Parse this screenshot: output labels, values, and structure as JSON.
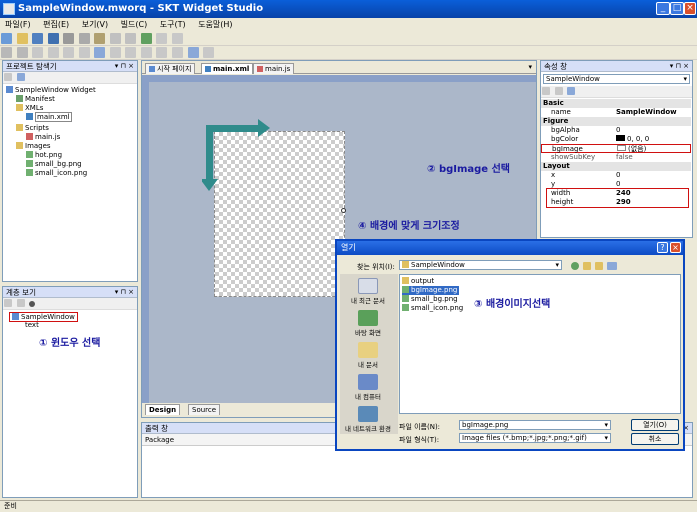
{
  "window": {
    "title": "SampleWindow.mworq - SKT Widget Studio"
  },
  "menu": [
    "파일(F)",
    "편집(E)",
    "보기(V)",
    "빌드(C)",
    "도구(T)",
    "도움말(H)"
  ],
  "project_explorer": {
    "title": "프로젝트 탐색기",
    "items": [
      "SampleWindow Widget",
      "Manifest",
      "XMLs",
      "main.xml",
      "Scripts",
      "main.js",
      "Images",
      "hot.png",
      "small_bg.png",
      "small_icon.png"
    ]
  },
  "layer_view": {
    "title": "계층 보기",
    "items": [
      "SampleWindow",
      "text"
    ]
  },
  "tabs": [
    "시작 페이지",
    "main.xml",
    "main.js"
  ],
  "bottom_tabs": {
    "design": "Design",
    "source": "Source"
  },
  "output": {
    "title": "출력 창",
    "package_label": "Package"
  },
  "properties": {
    "title": "속성 창",
    "object": "SampleWindow",
    "categories": {
      "basic": "Basic",
      "figure": "Figure",
      "layout": "Layout"
    },
    "rows": {
      "name": {
        "k": "name",
        "v": "SampleWindow"
      },
      "bgAlpha": {
        "k": "bgAlpha",
        "v": "0"
      },
      "bgColor": {
        "k": "bgColor",
        "v": "0, 0, 0"
      },
      "bgImage": {
        "k": "bgImage",
        "v": "(없음)"
      },
      "showSubKey": {
        "k": "showSubKey",
        "v": "false"
      },
      "x": {
        "k": "x",
        "v": "0"
      },
      "y": {
        "k": "y",
        "v": "0"
      },
      "width": {
        "k": "width",
        "v": "240"
      },
      "height": {
        "k": "height",
        "v": "290"
      }
    }
  },
  "annotations": {
    "a1": "① 윈도우 선택",
    "a2": "② bgImage 선택",
    "a3": "③ 배경이미지선택",
    "a4": "④ 배경에 맞게 크기조정"
  },
  "dialog": {
    "title": "열기",
    "lookin_label": "찾는 위치(I):",
    "lookin_value": "SampleWindow",
    "places": [
      "내 최근 문서",
      "바탕 화면",
      "내 문서",
      "내 컴퓨터",
      "내 네트워크 환경"
    ],
    "files": [
      "output",
      "bgImage.png",
      "small_bg.png",
      "small_icon.png"
    ],
    "filename_label": "파일 이름(N):",
    "filename_value": "bgImage.png",
    "filetype_label": "파일 형식(T):",
    "filetype_value": "Image files (*.bmp;*.jpg;*.png;*.gif)",
    "open_button": "열기(O)",
    "cancel_button": "취소",
    "help_button": "?"
  },
  "statusbar": {
    "text": "준비"
  },
  "colors": {
    "title_blue": "#0a5fd9",
    "annotation": "#1a1aa0",
    "highlight_red": "#d01010",
    "arrow_teal": "#2f8b8b"
  }
}
